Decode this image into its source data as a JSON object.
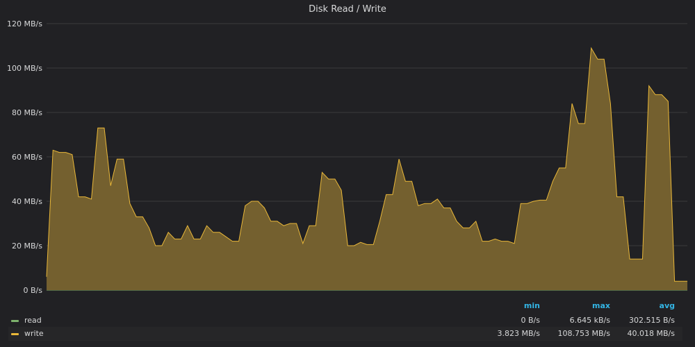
{
  "panel": {
    "title": "Disk Read / Write"
  },
  "colors": {
    "background": "#212124",
    "grid": "#3a3a3d",
    "axis_text": "#d8d9da",
    "read": "#7eb26d",
    "write": "#eab839",
    "write_fill": "#74602f",
    "legend_header": "#33b5e5"
  },
  "legend": {
    "headers": {
      "min": "min",
      "max": "max",
      "avg": "avg"
    },
    "rows": [
      {
        "name": "read",
        "min": "0 B/s",
        "max": "6.645 kB/s",
        "avg": "302.515 B/s"
      },
      {
        "name": "write",
        "min": "3.823 MB/s",
        "max": "108.753 MB/s",
        "avg": "40.018 MB/s"
      }
    ]
  },
  "chart_data": {
    "type": "area",
    "title": "Disk Read / Write",
    "y_unit": "MB/s",
    "ylim": [
      0,
      120
    ],
    "yticks": [
      0,
      20,
      40,
      60,
      80,
      100,
      120
    ],
    "ytick_labels": [
      "0 B/s",
      "20 MB/s",
      "40 MB/s",
      "60 MB/s",
      "80 MB/s",
      "100 MB/s",
      "120 MB/s"
    ],
    "grid": true,
    "legend_position": "bottom",
    "series": [
      {
        "name": "read",
        "values": [
          0,
          0,
          0,
          0,
          0,
          0,
          0,
          0,
          0,
          0,
          0,
          0,
          0,
          0,
          0,
          0,
          0,
          0,
          0,
          0,
          0,
          0,
          0,
          0,
          0,
          0,
          0,
          0,
          0,
          0,
          0,
          0,
          0,
          0,
          0,
          0,
          0,
          0,
          0,
          0,
          0,
          0,
          0,
          0,
          0,
          0,
          0,
          0,
          0,
          0,
          0,
          0,
          0,
          0,
          0,
          0,
          0,
          0,
          0,
          0,
          0,
          0,
          0,
          0,
          0,
          0,
          0,
          0,
          0,
          0,
          0,
          0,
          0,
          0,
          0,
          0,
          0,
          0,
          0,
          0,
          0,
          0,
          0,
          0,
          0,
          0,
          0,
          0,
          0,
          0,
          0,
          0,
          0,
          0,
          0,
          0,
          0,
          0,
          0,
          0,
          0,
          0,
          0,
          0,
          0,
          0,
          0,
          0,
          0,
          0,
          0,
          0,
          0,
          0,
          0,
          0,
          0,
          0,
          0,
          0,
          0,
          0,
          0,
          0,
          0,
          0,
          0,
          0,
          0,
          0,
          0,
          0
        ]
      },
      {
        "name": "write",
        "values": [
          6,
          63,
          62,
          62,
          61,
          42,
          42,
          41,
          73,
          73,
          47,
          59,
          59,
          39,
          33,
          33,
          28,
          20,
          20,
          26,
          23,
          23,
          29,
          23,
          23,
          29,
          26,
          26,
          24,
          22,
          22,
          38,
          40,
          40,
          37,
          31,
          31,
          29,
          30,
          30,
          21,
          29,
          29,
          53,
          50,
          50,
          45,
          20,
          20,
          21.5,
          20.5,
          20.5,
          31,
          43,
          43,
          59,
          49,
          49,
          38,
          39,
          39,
          41,
          37,
          37,
          31,
          28,
          28,
          31,
          22,
          22,
          23,
          22,
          22,
          21,
          39,
          39,
          40,
          40.5,
          40.5,
          49,
          55,
          55,
          84,
          75,
          75,
          109,
          104,
          104,
          84,
          42,
          42,
          14,
          14,
          14,
          92,
          88,
          88,
          85,
          4,
          4,
          4
        ]
      }
    ]
  }
}
